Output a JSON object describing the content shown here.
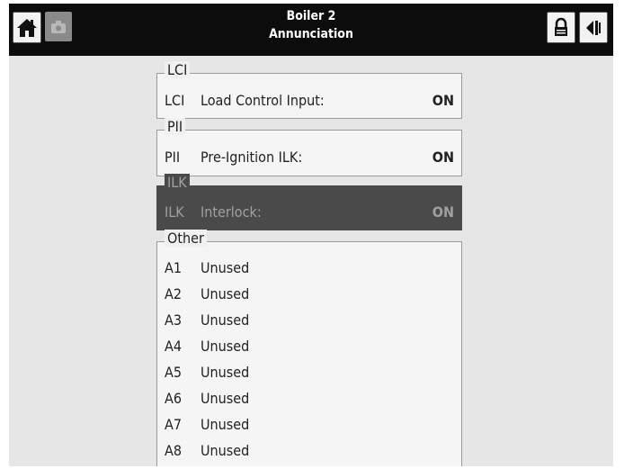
{
  "header": {
    "title_line1": "Boiler 2",
    "title_line2": "Annunciation",
    "icons": [
      "home-icon",
      "camera-icon",
      "lock-icon",
      "back-arrow-icon"
    ]
  },
  "groups": {
    "lci": {
      "title": "LCI",
      "code": "LCI",
      "desc": "Load Control Input:",
      "value": "ON"
    },
    "pii": {
      "title": "PII",
      "code": "PII",
      "desc": "Pre-Ignition ILK:",
      "value": "ON"
    },
    "ilk": {
      "title": "ILK",
      "code": "ILK",
      "desc": "Interlock:",
      "value": "ON"
    },
    "other": {
      "title": "Other",
      "items": [
        {
          "code": "A1",
          "desc": "Unused"
        },
        {
          "code": "A2",
          "desc": "Unused"
        },
        {
          "code": "A3",
          "desc": "Unused"
        },
        {
          "code": "A4",
          "desc": "Unused"
        },
        {
          "code": "A5",
          "desc": "Unused"
        },
        {
          "code": "A6",
          "desc": "Unused"
        },
        {
          "code": "A7",
          "desc": "Unused"
        },
        {
          "code": "A8",
          "desc": "Unused"
        }
      ]
    }
  },
  "colors": {
    "header_bg": "#0c0c0c",
    "panel_bg": "#e6e6e6",
    "ilk_bg": "#4a4a4a"
  }
}
